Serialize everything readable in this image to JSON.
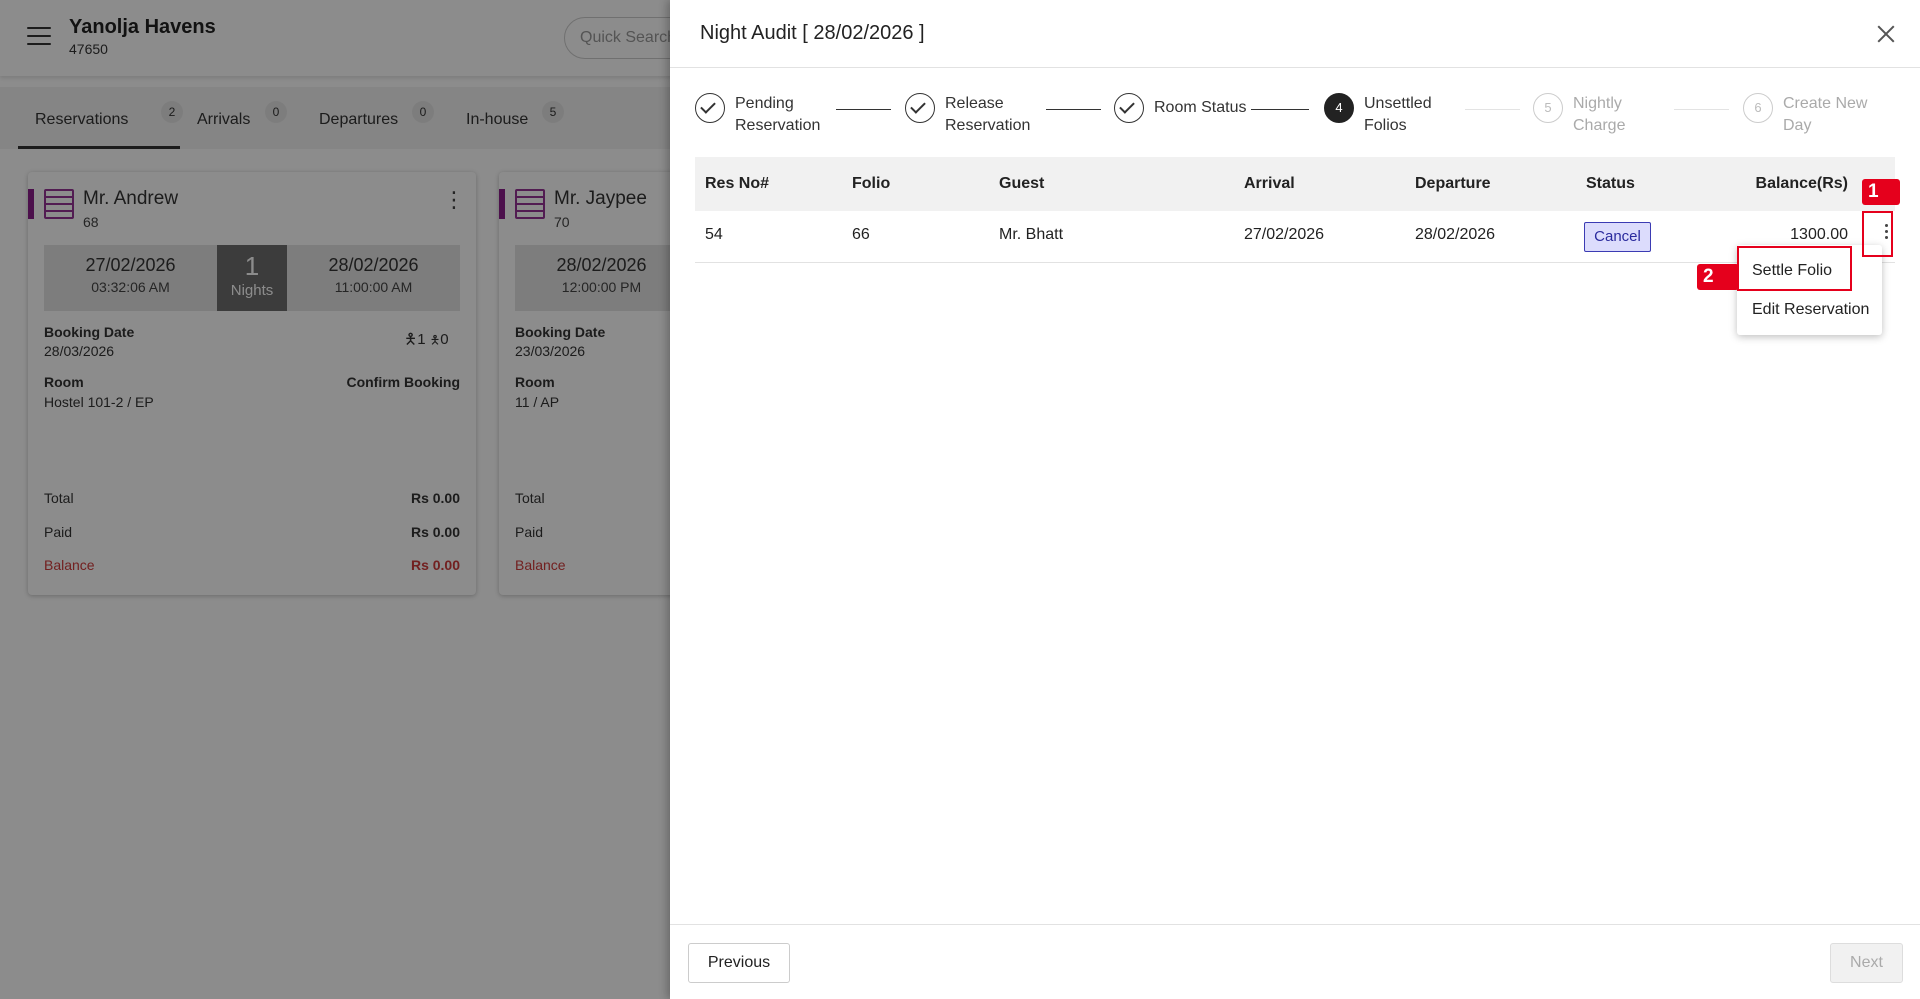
{
  "app": {
    "hotel_name": "Yanolja Havens",
    "hotel_id": "47650",
    "search_placeholder": "Quick Search"
  },
  "tabs": [
    {
      "label": "Reservations",
      "count": "2",
      "active": true
    },
    {
      "label": "Arrivals",
      "count": "0"
    },
    {
      "label": "Departures",
      "count": "0"
    },
    {
      "label": "In-house",
      "count": "5"
    }
  ],
  "cards": [
    {
      "guest": "Mr. Andrew",
      "id": "68",
      "arrival_date": "27/02/2026",
      "arrival_time": "03:32:06 AM",
      "nights": "1",
      "nights_label": "Nights",
      "departure_date": "28/02/2026",
      "departure_time": "11:00:00 AM",
      "booking_date_label": "Booking Date",
      "booking_date": "28/03/2026",
      "adults": "1",
      "children": "0",
      "room_label": "Room",
      "room": "Hostel 101-2 / EP",
      "status": "Confirm Booking",
      "total_label": "Total",
      "total": "Rs 0.00",
      "paid_label": "Paid",
      "paid": "Rs 0.00",
      "balance_label": "Balance",
      "balance": "Rs 0.00"
    },
    {
      "guest": "Mr. Jaypee",
      "id": "70",
      "arrival_date": "28/02/2026",
      "arrival_time": "12:00:00 PM",
      "booking_date_label": "Booking Date",
      "booking_date": "23/03/2026",
      "room_label": "Room",
      "room": "11 / AP",
      "total_label": "Total",
      "paid_label": "Paid",
      "balance_label": "Balance"
    }
  ],
  "panel": {
    "title": "Night Audit [ 28/02/2026 ]",
    "steps": [
      {
        "line1": "Pending",
        "line2": "Reservation",
        "state": "done"
      },
      {
        "line1": "Release",
        "line2": "Reservation",
        "state": "done"
      },
      {
        "line1": "Room Status",
        "line2": "",
        "state": "done"
      },
      {
        "number": "4",
        "line1": "Unsettled",
        "line2": "Folios",
        "state": "current"
      },
      {
        "number": "5",
        "line1": "Nightly",
        "line2": "Charge",
        "state": "future"
      },
      {
        "number": "6",
        "line1": "Create New",
        "line2": "Day",
        "state": "future"
      }
    ],
    "table": {
      "columns": [
        "Res No#",
        "Folio",
        "Guest",
        "Arrival",
        "Departure",
        "Status",
        "Balance(Rs)"
      ],
      "rows": [
        {
          "res_no": "54",
          "folio": "66",
          "guest": "Mr. Bhatt",
          "arrival": "27/02/2026",
          "departure": "28/02/2026",
          "status": "Cancel",
          "balance": "1300.00"
        }
      ]
    },
    "row_menu": [
      "Settle Folio",
      "Edit Reservation"
    ],
    "annotations": [
      "1",
      "2"
    ],
    "previous_label": "Previous",
    "next_label": "Next"
  },
  "colors": {
    "accent_purple": "#8b1e8b",
    "annotation_red": "#e5001c",
    "status_cancel_bg": "#dcdcfc",
    "balance_red": "#d03b3b"
  }
}
